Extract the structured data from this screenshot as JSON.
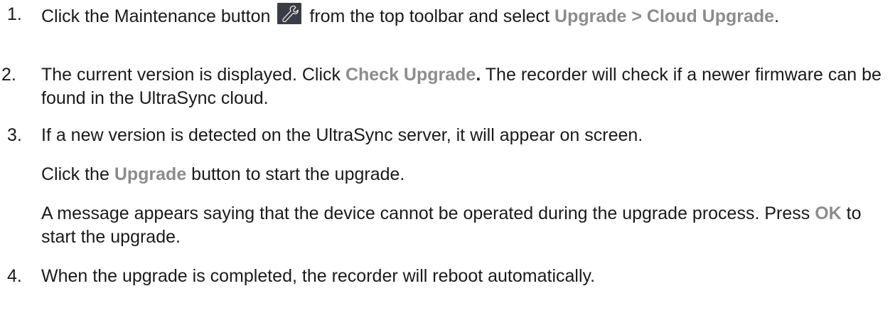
{
  "steps": [
    {
      "number": "1.",
      "text_before_icon": "Click the Maintenance button",
      "text_after_icon": " from the top toolbar and select ",
      "highlight": "Upgrade > Cloud Upgrade",
      "text_end": "."
    },
    {
      "number": "2.",
      "text_before": "The current version is displayed. Click ",
      "highlight": "Check Upgrade",
      "highlight_end": ".",
      "text_after": " The recorder will check if a newer firmware can be found in the UltraSync cloud."
    },
    {
      "number": "3.",
      "text": "If a new version is detected on the UltraSync server, it will appear on screen.",
      "para2_before": "Click the ",
      "para2_highlight": "Upgrade",
      "para2_after": " button to start the upgrade.",
      "para3_before": "A message appears saying that the device cannot be operated during the upgrade process. Press ",
      "para3_highlight": "OK",
      "para3_after": " to start the upgrade."
    },
    {
      "number": "4.",
      "text": "When the upgrade is completed, the recorder will reboot automatically."
    }
  ],
  "icons": {
    "maintenance": "wrench-icon"
  },
  "colors": {
    "text": "#1a1a1a",
    "highlight": "#8c8c8c",
    "icon_background": "#3c3d44"
  }
}
